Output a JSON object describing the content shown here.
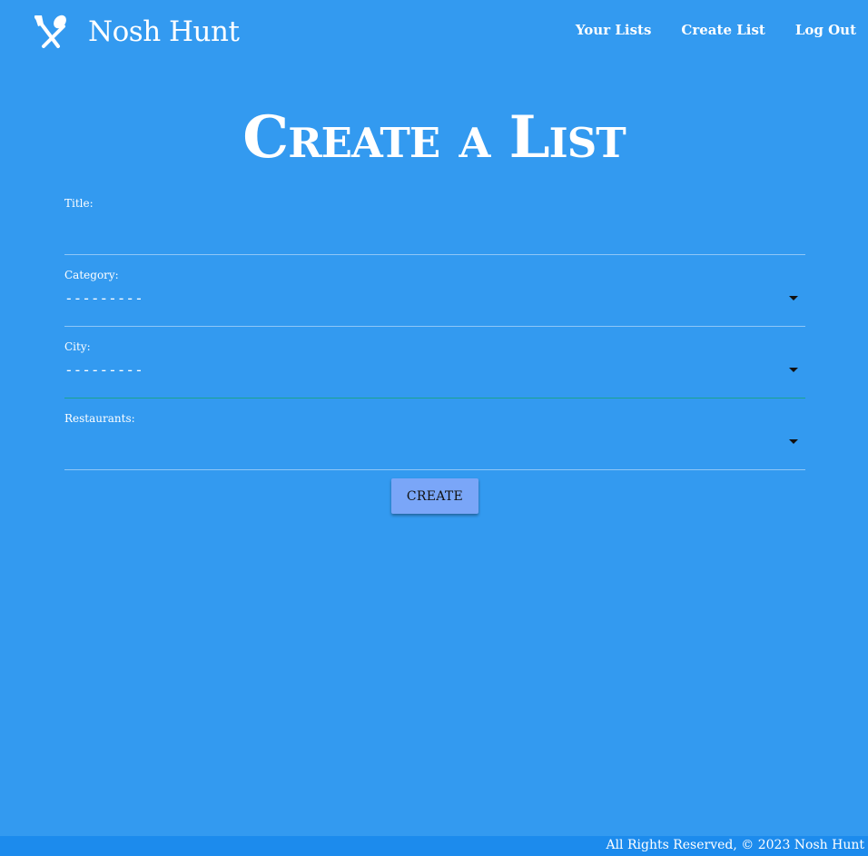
{
  "nav": {
    "brand_name": "Nosh Hunt",
    "brand_icon": "fork-spoon-icon",
    "links": [
      "Your Lists",
      "Create List",
      "Log Out"
    ]
  },
  "page": {
    "title": "Create a List"
  },
  "form": {
    "title_label": "Title:",
    "title_value": "",
    "category_label": "Category:",
    "category_value": "---------",
    "city_label": "City:",
    "city_value": "---------",
    "restaurants_label": "Restaurants:",
    "restaurants_value": "",
    "submit_label": "CREATE"
  },
  "footer": {
    "text": "All Rights Reserved, © 2023 Nosh Hunt"
  },
  "colors": {
    "background": "#339af0",
    "footer": "#1c8bed",
    "button": "#7aa6f8",
    "focus_line": "#1aa38f"
  }
}
